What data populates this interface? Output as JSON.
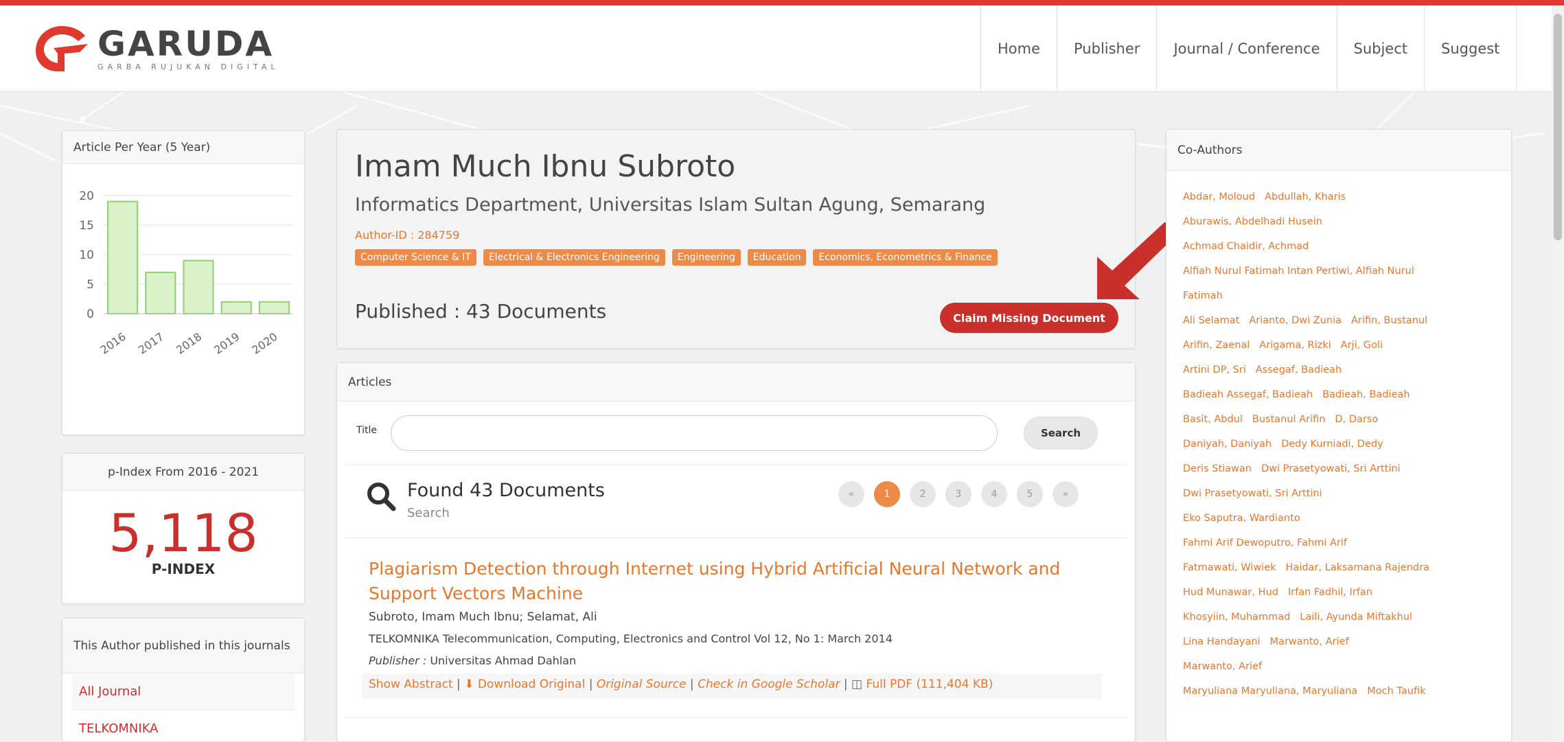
{
  "brand": {
    "name": "GARUDA",
    "tagline": "GARBA RUJUKAN DIGITAL",
    "accent": "#e03a2f",
    "orange": "#e8772e"
  },
  "nav": [
    "Home",
    "Publisher",
    "Journal / Conference",
    "Subject",
    "Suggest"
  ],
  "chart_panel": {
    "title": "Article Per Year (5 Year)"
  },
  "chart_data": {
    "type": "bar",
    "categories": [
      "2016",
      "2017",
      "2018",
      "2019",
      "2020"
    ],
    "values": [
      19,
      7,
      9,
      2,
      2
    ],
    "ylim": [
      0,
      20
    ],
    "yticks": [
      "0",
      "5",
      "10",
      "15",
      "20"
    ],
    "bar_color": "#d9f2c9",
    "bar_stroke": "#8fd070",
    "grid": true
  },
  "pindex": {
    "title": "p-Index From 2016 - 2021",
    "value": "5,118",
    "label": "P-INDEX"
  },
  "journals": {
    "title": "This Author published in this journals",
    "items": [
      "All Journal",
      "TELKOMNIKA"
    ]
  },
  "author": {
    "name": "Imam Much Ibnu Subroto",
    "affiliation": "Informatics Department, Universitas Islam Sultan Agung, Semarang",
    "author_id": "Author-ID : 284759",
    "tags": [
      "Computer Science & IT",
      "Electrical & Electronics Engineering",
      "Engineering",
      "Education",
      "Economics, Econometrics & Finance"
    ],
    "published": "Published : 43 Documents",
    "claim_label": "Claim Missing Document"
  },
  "articles": {
    "header": "Articles",
    "title_label": "Title",
    "search_label": "Search",
    "found": "Found 43 Documents",
    "found_sub": "Search",
    "pages": [
      "«",
      "1",
      "2",
      "3",
      "4",
      "5",
      "»"
    ],
    "items": [
      {
        "title": "Plagiarism Detection through Internet using Hybrid Artificial Neural Network and Support Vectors Machine",
        "authors": "Subroto, Imam Much Ibnu; Selamat, Ali",
        "journal": "TELKOMNIKA Telecommunication, Computing, Electronics and Control Vol 12, No 1: March 2014",
        "publisher_label": "Publisher :",
        "publisher": "Universitas Ahmad Dahlan",
        "links": {
          "abstract": "Show Abstract",
          "download": "Download Original",
          "source": "Original Source",
          "scholar": "Check in Google Scholar",
          "pdf": "Full PDF (111,404 KB)"
        }
      }
    ]
  },
  "coauthors": {
    "title": "Co-Authors",
    "lines": [
      [
        "Abdar, Moloud",
        "Abdullah, Kharis"
      ],
      [
        "Aburawis, Abdelhadi Husein"
      ],
      [
        "Achmad Chaidir, Achmad"
      ],
      [
        "Alfiah Nurul Fatimah Intan Pertiwi, Alfiah Nurul"
      ],
      [
        "Fatimah"
      ],
      [
        "Ali Selamat",
        "Arianto, Dwi Zunia",
        "Arifin, Bustanul"
      ],
      [
        "Arifin, Zaenal",
        "Arigama, Rizki",
        "Arji, Goli"
      ],
      [
        "Artini DP, Sri",
        "Assegaf, Badieah"
      ],
      [
        "Badieah Assegaf, Badieah",
        "Badieah, Badieah"
      ],
      [
        "Basit, Abdul",
        "Bustanul Arifin",
        "D, Darso"
      ],
      [
        "Daniyah, Daniyah",
        "Dedy Kurniadi, Dedy"
      ],
      [
        "Deris Stiawan",
        "Dwi Prasetyowati, Sri Arttini"
      ],
      [
        "Dwi Prasetyowati, Sri Arttini"
      ],
      [
        "Eko Saputra, Wardianto"
      ],
      [
        "Fahmi Arif Dewoputro, Fahmi Arif"
      ],
      [
        "Fatmawati, Wiwiek",
        "Haidar, Laksamana Rajendra"
      ],
      [
        "Hud Munawar, Hud",
        "Irfan Fadhil, Irfan"
      ],
      [
        "Khosyiin, Muhammad",
        "Laili, Ayunda Miftakhul"
      ],
      [
        "Lina Handayani",
        "Marwanto, Arief"
      ],
      [
        "Marwanto, Arief"
      ],
      [
        "Maryuliana Maryuliana, Maryuliana",
        "Moch Taufik"
      ]
    ]
  }
}
